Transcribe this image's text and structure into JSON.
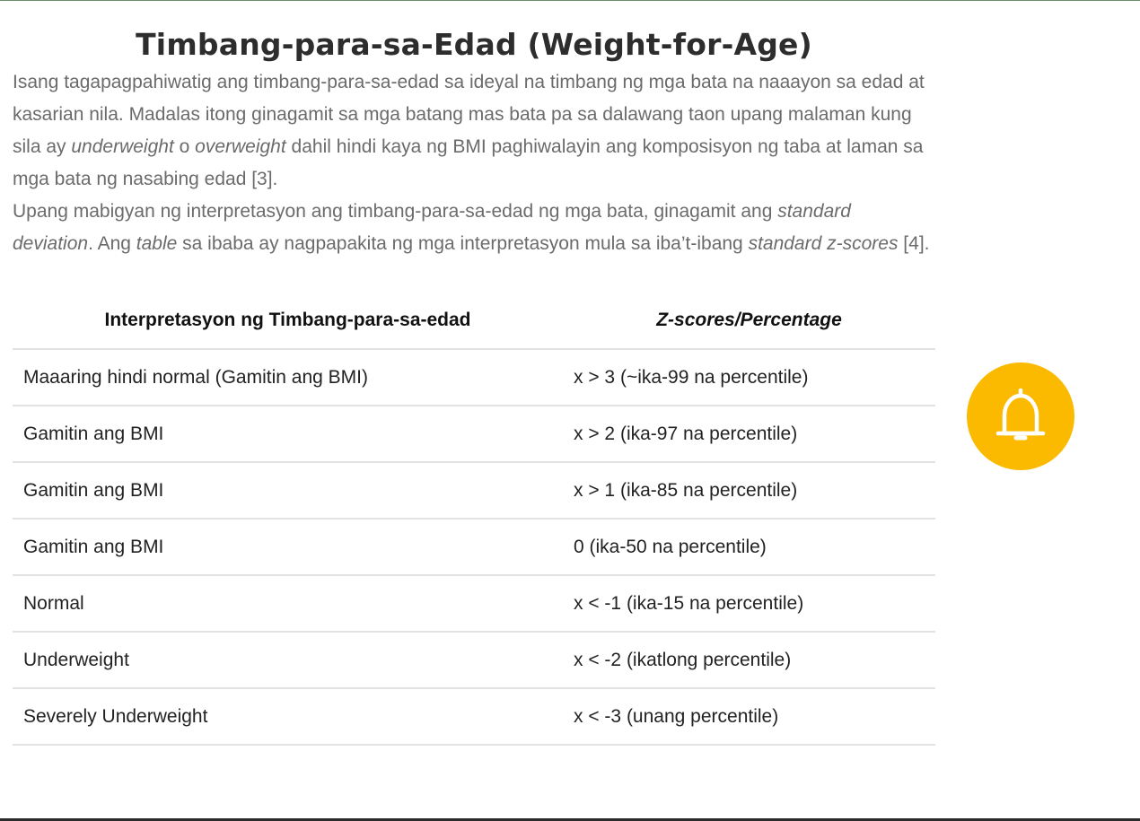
{
  "article": {
    "title": "Timbang-para-sa-Edad (Weight-for-Age)",
    "paragraph1": {
      "text_a": "Isang tagapagpahiwatig ang timbang-para-sa-edad sa ideyal na timbang ng mga bata na naaayon sa edad at kasarian nila. Madalas itong ginagamit sa mga batang mas bata pa sa dalawang taon upang malaman kung sila ay ",
      "em_a": "underweight",
      "text_b": " o ",
      "em_b": "overweight",
      "text_c": " dahil hindi kaya ng BMI paghiwalayin ang komposisyon ng taba at laman sa mga bata ng nasabing edad [3]."
    },
    "paragraph2": {
      "text_a": "Upang mabigyan ng interpretasyon ang timbang-para-sa-edad ng mga bata, ginagamit ang ",
      "em_a": "standard deviation",
      "text_b": ". Ang ",
      "em_b": "table",
      "text_c": " sa ibaba ay nagpapakita ng mga interpretasyon mula sa iba’t-ibang ",
      "em_c": "standard z-scores",
      "text_d": " [4]."
    }
  },
  "table": {
    "headers": [
      "Interpretasyon ng Timbang-para-sa-edad",
      "Z-scores/Percentage"
    ],
    "rows": [
      [
        "Maaaring hindi normal (Gamitin ang BMI)",
        "x > 3 (~ika-99 na percentile)"
      ],
      [
        "Gamitin ang BMI",
        "x > 2 (ika-97 na percentile)"
      ],
      [
        "Gamitin ang BMI",
        "x > 1 (ika-85 na percentile)"
      ],
      [
        "Gamitin ang BMI",
        "0 (ika-50 na percentile)"
      ],
      [
        "Normal",
        "x < -1 (ika-15 na percentile)"
      ],
      [
        "Underweight",
        "x < -2 (ikatlong percentile)"
      ],
      [
        "Severely Underweight",
        "x < -3 (unang percentile)"
      ]
    ]
  },
  "notification_button": {
    "icon": "bell-icon",
    "color": "#fbb900"
  }
}
